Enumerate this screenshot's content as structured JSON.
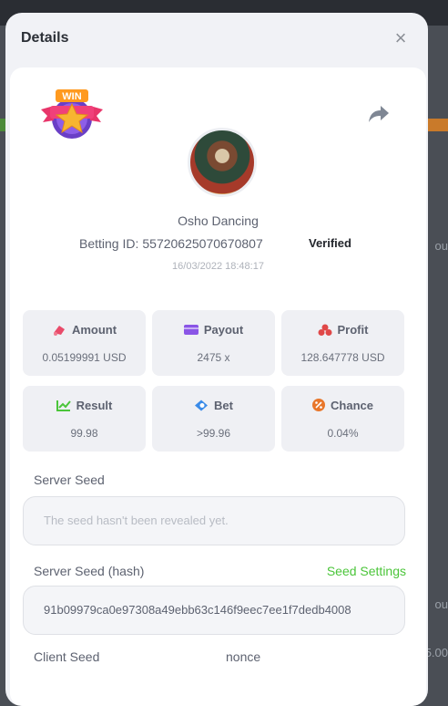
{
  "background": {
    "snippet_1": "ou",
    "snippet_2": "ou",
    "snippet_3": "5.00"
  },
  "modal": {
    "title": "Details"
  },
  "game": {
    "name": "Osho Dancing"
  },
  "bet": {
    "id_label": "Betting ID:",
    "id_value": "55720625070670807",
    "status": "Verified",
    "timestamp": "16/03/2022 18:48:17"
  },
  "stats": {
    "amount": {
      "label": "Amount",
      "value": "0.05199991 USD"
    },
    "payout": {
      "label": "Payout",
      "value": "2475 x"
    },
    "profit": {
      "label": "Profit",
      "value": "128.647778 USD"
    },
    "result": {
      "label": "Result",
      "value": "99.98"
    },
    "bet": {
      "label": "Bet",
      "value": ">99.96"
    },
    "chance": {
      "label": "Chance",
      "value": "0.04%"
    }
  },
  "server_seed": {
    "label": "Server Seed",
    "placeholder": "The seed hasn't been revealed yet."
  },
  "server_seed_hash": {
    "label": "Server Seed (hash)",
    "settings_link": "Seed Settings",
    "value": "91b09979ca0e97308a49ebb63c146f9eec7ee1f7dedb4008"
  },
  "client_seed": {
    "label": "Client Seed",
    "nonce_label": "nonce"
  },
  "colors": {
    "accent_green": "#4bc53a",
    "amount_icon": "#e94b6a",
    "payout_icon": "#8a55e6",
    "profit_icon": "#e04848",
    "result_icon": "#4bc53a",
    "bet_icon": "#3a8be8",
    "chance_icon": "#e8762a"
  },
  "icons": {
    "badge": "win-badge-icon",
    "share": "share-arrow-icon",
    "close": "close-icon"
  }
}
